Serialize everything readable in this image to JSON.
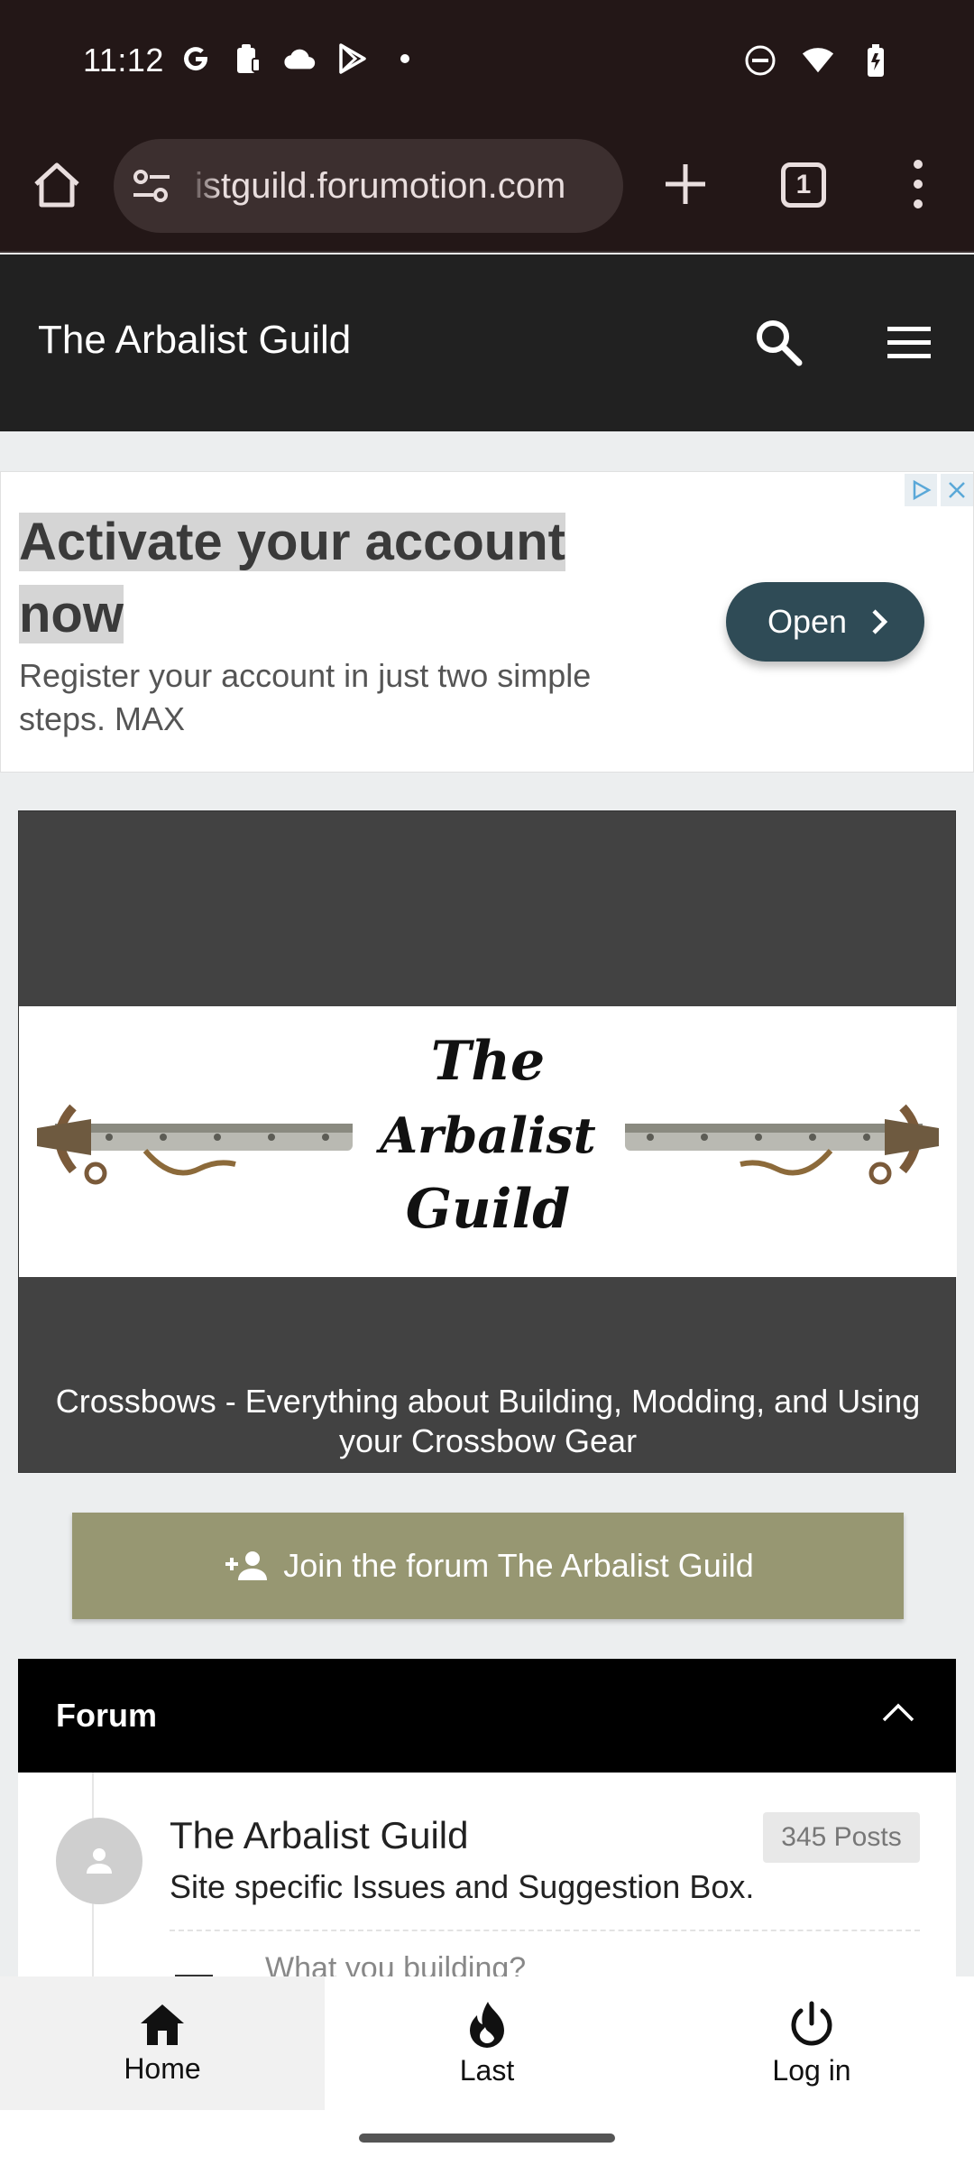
{
  "status_bar": {
    "time": "11:12",
    "left_icons": [
      "google-icon",
      "clipboard-icon",
      "cloud-icon",
      "play-store-icon",
      "dot-icon"
    ],
    "right_icons": [
      "dnd-icon",
      "wifi-icon",
      "battery-icon"
    ]
  },
  "browser": {
    "url": "istguild.forumotion.com",
    "tab_count": "1"
  },
  "site": {
    "title": "The Arbalist Guild"
  },
  "ad": {
    "headline_line1": "Activate your account",
    "headline_line2": "now",
    "description": "Register your account in just two simple steps. MAX",
    "button_label": "Open"
  },
  "banner": {
    "logo_line1": "The",
    "logo_line2": "Arbalist",
    "logo_line3": "Guild",
    "caption": "Crossbows - Everything about Building, Modding, and Using your Crossbow Gear"
  },
  "join_button": {
    "label": "Join the forum The Arbalist Guild"
  },
  "forum": {
    "header": "Forum",
    "items": [
      {
        "title": "The Arbalist Guild",
        "description": "Site specific Issues and Suggestion Box.",
        "posts": "345 Posts",
        "subforum": "What you building?"
      }
    ]
  },
  "bottom_nav": {
    "items": [
      {
        "label": "Home",
        "icon": "home-icon"
      },
      {
        "label": "Last",
        "icon": "flame-icon"
      },
      {
        "label": "Log in",
        "icon": "power-icon"
      }
    ]
  },
  "colors": {
    "status_bg": "#231717",
    "header_bg": "#212121",
    "join_bg": "#979772",
    "ad_button_bg": "#2f4b56"
  }
}
